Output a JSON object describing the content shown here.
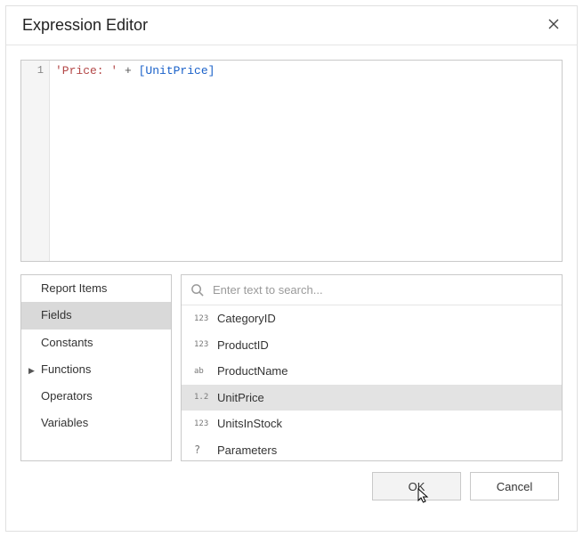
{
  "dialog": {
    "title": "Expression Editor"
  },
  "editor": {
    "line_number": "1",
    "tokens": {
      "string": "'Price: '",
      "operator": " + ",
      "field": "[UnitPrice]"
    }
  },
  "categories": [
    {
      "label": "Report Items",
      "selected": false,
      "expandable": false
    },
    {
      "label": "Fields",
      "selected": true,
      "expandable": false
    },
    {
      "label": "Constants",
      "selected": false,
      "expandable": false
    },
    {
      "label": "Functions",
      "selected": false,
      "expandable": true
    },
    {
      "label": "Operators",
      "selected": false,
      "expandable": false
    },
    {
      "label": "Variables",
      "selected": false,
      "expandable": false
    }
  ],
  "search": {
    "placeholder": "Enter text to search..."
  },
  "fields": [
    {
      "type": "123",
      "label": "CategoryID",
      "selected": false
    },
    {
      "type": "123",
      "label": "ProductID",
      "selected": false
    },
    {
      "type": "ab",
      "label": "ProductName",
      "selected": false
    },
    {
      "type": "1.2",
      "label": "UnitPrice",
      "selected": true
    },
    {
      "type": "123",
      "label": "UnitsInStock",
      "selected": false
    },
    {
      "type": "?",
      "label": "Parameters",
      "selected": false
    }
  ],
  "buttons": {
    "ok": "OK",
    "cancel": "Cancel"
  }
}
